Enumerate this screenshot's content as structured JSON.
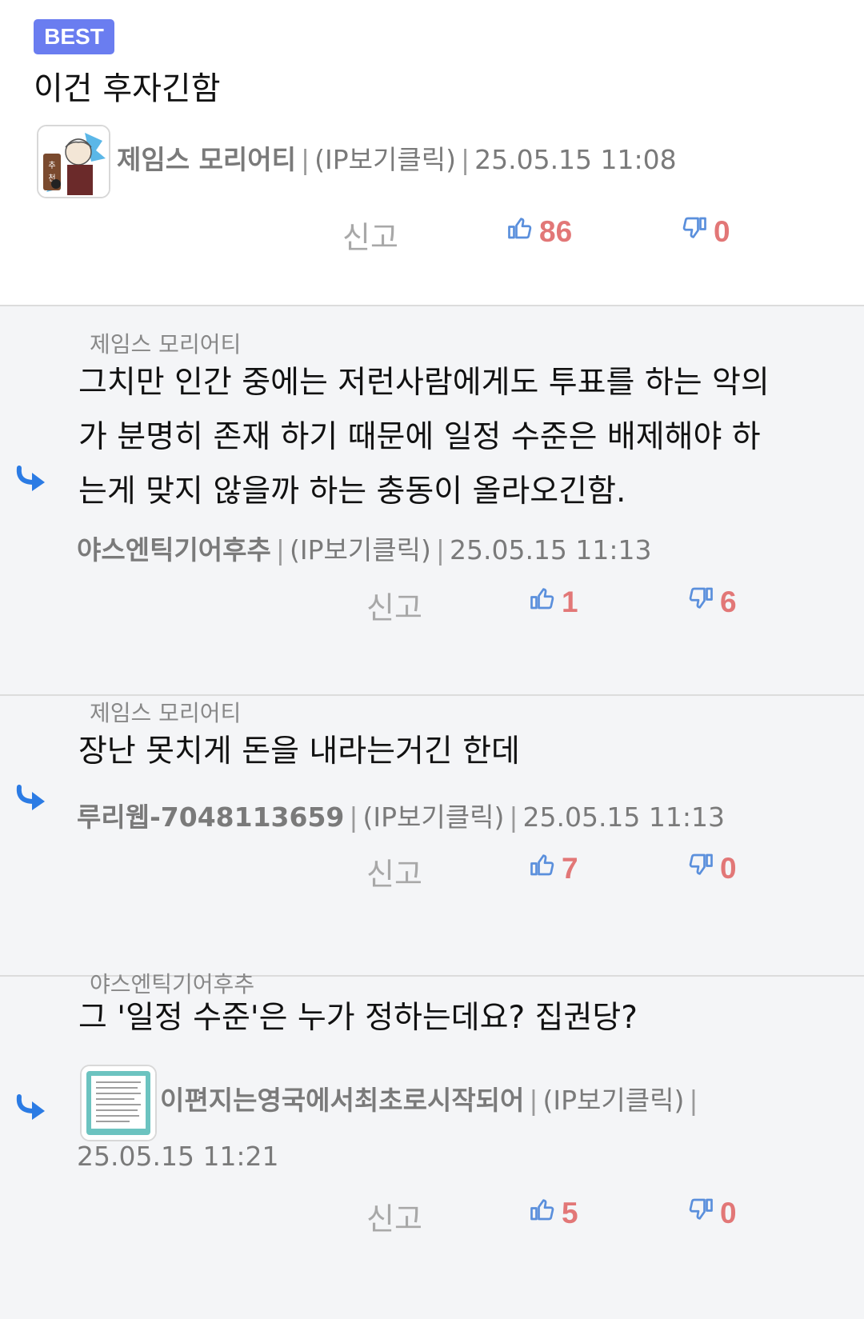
{
  "best_comment": {
    "badge": "BEST",
    "text": "이건 후자긴함",
    "author": "제임스 모리어티",
    "ip": "(IP보기클릭)",
    "datetime": "25.05.15 11:08",
    "report_label": "신고",
    "likes": "86",
    "dislikes": "0"
  },
  "replies": [
    {
      "parent": "제임스 모리어티",
      "lines": [
        "그치만 인간 중에는 저런사람에게도 투표를 하는 악의",
        "가 분명히 존재 하기 때문에 일정 수준은 배제해야 하",
        "는게 맞지 않을까 하는 충동이 올라오긴함."
      ],
      "author": "야스엔틱기어후추",
      "ip": "(IP보기클릭)",
      "datetime": "25.05.15 11:13",
      "report_label": "신고",
      "likes": "1",
      "dislikes": "6"
    },
    {
      "parent": "제임스 모리어티",
      "lines": [
        "장난 못치게 돈을 내라는거긴 한데"
      ],
      "author": "루리웹-7048113659",
      "ip": "(IP보기클릭)",
      "datetime": "25.05.15 11:13",
      "report_label": "신고",
      "likes": "7",
      "dislikes": "0"
    },
    {
      "parent": "야스엔틱기어후추",
      "lines": [
        "그 '일정 수준'은 누가 정하는데요? 집권당?"
      ],
      "author": "이편지는영국에서최초로시작되어",
      "ip": "(IP보기클릭)",
      "datetime": "25.05.15 11:21",
      "report_label": "신고",
      "likes": "5",
      "dislikes": "0"
    }
  ],
  "icons": {
    "thumb_up": "thumbs-up-icon",
    "thumb_down": "thumbs-down-icon",
    "reply_arrow": "reply-arrow-icon"
  },
  "colors": {
    "badge": "#6a7df0",
    "vote_count": "#e27777",
    "thumb_icon": "#5a8fdc",
    "reply_arrow": "#2b7be4",
    "reply_bg": "#f4f5f7"
  }
}
